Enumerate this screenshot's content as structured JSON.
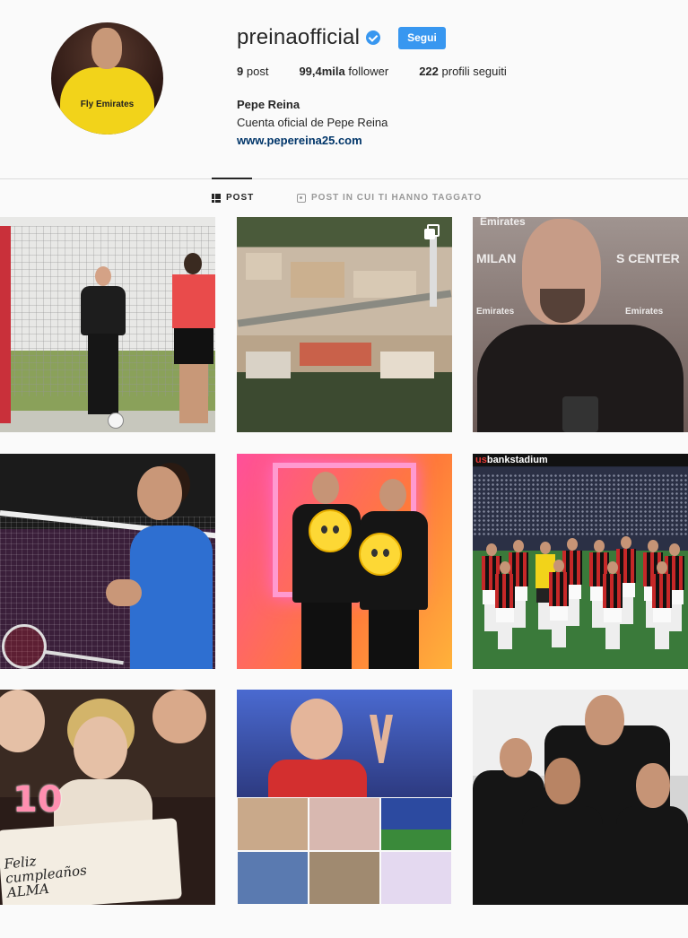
{
  "profile": {
    "username": "preinaofficial",
    "verified": true,
    "follow_label": "Segui",
    "avatar_shirt_text": "Fly Emirates",
    "stats": {
      "posts_value": "9",
      "posts_label": "post",
      "followers_value": "99,4mila",
      "followers_label": "follower",
      "following_value": "222",
      "following_label": "profili seguiti"
    },
    "full_name": "Pepe Reina",
    "bio": "Cuenta oficial de Pepe Reina",
    "website": "www.pepereina25.com"
  },
  "tabs": {
    "posts_label": "POST",
    "tagged_label": "POST IN CUI TI HANNO TAGGATO",
    "active": "posts"
  },
  "photos": {
    "p3_wall_1": "Emirates",
    "p3_wall_2": "MILAN",
    "p3_wall_3": "S CENTER",
    "p3_wall_4": "Emirates",
    "p3_wall_5": "Emirates",
    "p6_banner_prefix": "us",
    "p6_banner_rest": "bankstadium",
    "p7_candle": "10",
    "p7_cake_line1": "Feliz",
    "p7_cake_line2": "cumpleaños",
    "p7_cake_line3": "ALMA"
  },
  "icons": {
    "verified": "verified-badge-icon",
    "posts_tab": "grid-icon",
    "tagged_tab": "tagged-icon",
    "multi_photo": "carousel-icon"
  },
  "colors": {
    "accent": "#3897f0",
    "text": "#262626",
    "muted": "#999999",
    "link": "#003569",
    "background": "#fafafa"
  }
}
